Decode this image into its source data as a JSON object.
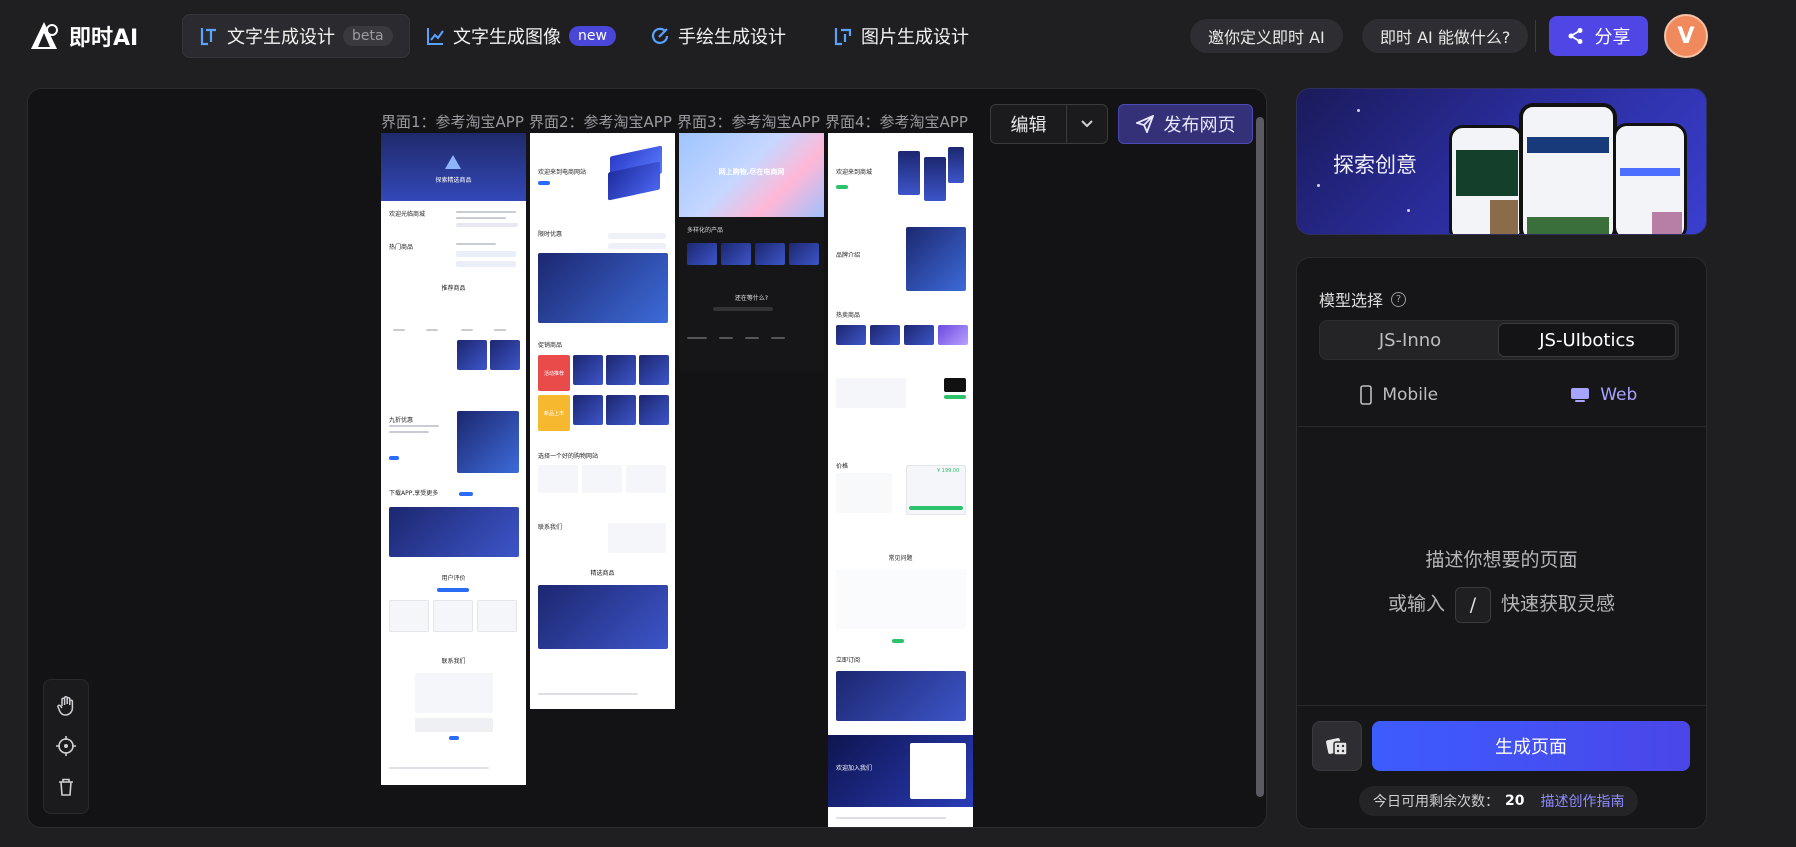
{
  "app": {
    "name": "即时AI"
  },
  "nav": {
    "tabs": [
      {
        "label": "文字生成设计",
        "badge": "beta",
        "active": true
      },
      {
        "label": "文字生成图像",
        "badge": "new",
        "active": false
      },
      {
        "label": "手绘生成设计",
        "badge": "",
        "active": false
      },
      {
        "label": "图片生成设计",
        "badge": "",
        "active": false
      }
    ]
  },
  "header": {
    "invite_label": "邀你定义即时 AI",
    "about_label": "即时 AI 能做什么?",
    "share_label": "分享",
    "avatar_initial": "V"
  },
  "canvas": {
    "screen_titles": [
      "界面1：参考淘宝APP",
      "界面2：参考淘宝APP",
      "界面3：参考淘宝APP",
      "界面4：参考淘宝APP"
    ],
    "edit_label": "编辑",
    "publish_label": "发布网页",
    "screen1": {
      "hero_title": "探索精选商品",
      "section1": "欢迎光临商城",
      "section2": "热门商品",
      "section3": "推荐商品",
      "section4": "九折优惠",
      "section5": "下载APP,享受更多",
      "section6": "用户评价",
      "section7": "联系我们"
    },
    "screen2": {
      "hero_title": "欢迎来到电商网站",
      "section1": "限时优惠",
      "section2": "促销商品",
      "tag_red": "活动推荐",
      "tag_yellow": "新品上市",
      "section3": "选择一个好的购物网站",
      "section4": "联系我们",
      "section5": "精选商品"
    },
    "screen3": {
      "hero_title": "网上购物,尽在电商网",
      "section1": "多样化的产品",
      "section2": "还在等什么?"
    },
    "screen4": {
      "hero_title": "欢迎来到商城",
      "section1": "品牌介绍",
      "section2": "热卖商品",
      "section3": "价格",
      "price": "¥ 199.00",
      "section4": "常见问题",
      "section5": "立即订阅",
      "footer_title": "欢迎加入我们"
    }
  },
  "explore": {
    "label": "探索创意"
  },
  "generator": {
    "model_label": "模型选择",
    "models": [
      "JS-Inno",
      "JS-UIbotics"
    ],
    "active_model": "JS-UIbotics",
    "devices": [
      {
        "label": "Mobile",
        "active": false
      },
      {
        "label": "Web",
        "active": true
      }
    ],
    "prompt_line1": "描述你想要的页面",
    "prompt_line2_prefix": "或输入",
    "prompt_key": "/",
    "prompt_line2_suffix": "快速获取灵感",
    "generate_label": "生成页面",
    "quota_label": "今日可用剩余次数：",
    "quota_value": "20",
    "guide_label": "描述创作指南"
  },
  "colors": {
    "accent": "#4f46e5",
    "background": "#1f1f22",
    "avatar": "#f08a5d"
  }
}
